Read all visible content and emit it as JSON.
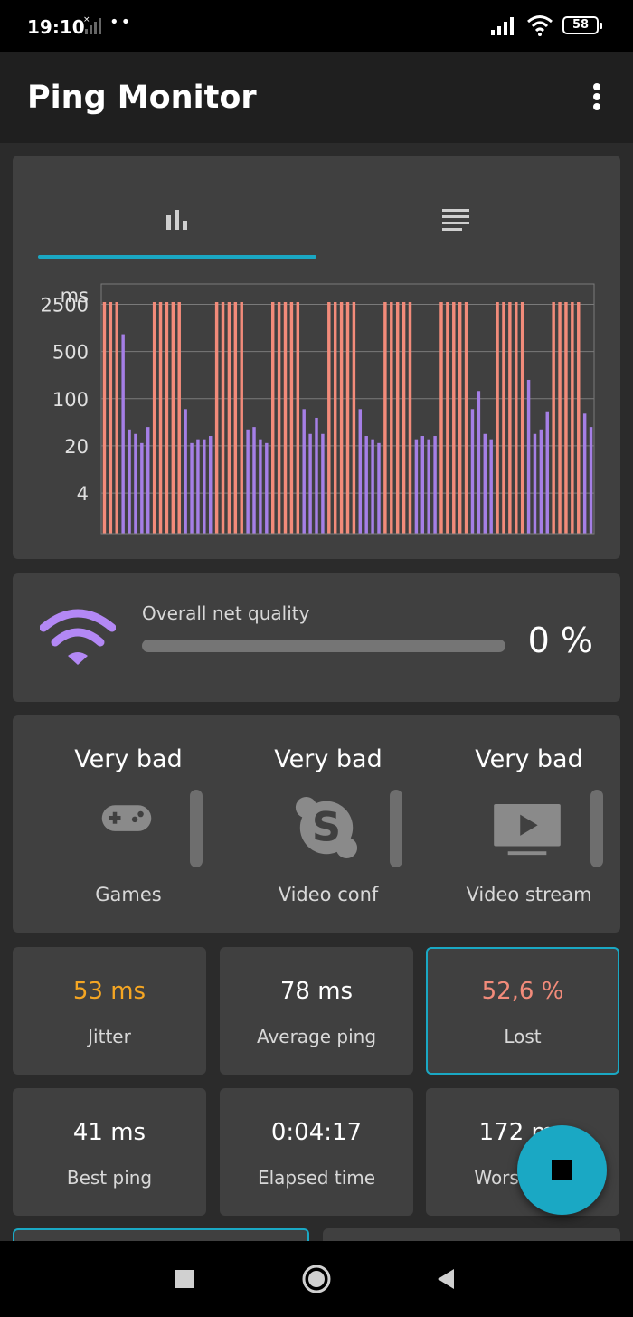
{
  "status_bar": {
    "time": "19:10",
    "dots": "••",
    "battery": "58"
  },
  "app_bar": {
    "title": "Ping Monitor",
    "menu_icon": "more-vert-icon"
  },
  "chart_tabs": {
    "active": "graph",
    "items": [
      {
        "id": "graph",
        "icon": "bar-chart-icon"
      },
      {
        "id": "list",
        "icon": "list-icon"
      }
    ]
  },
  "colors": {
    "accent": "#1aa8c4",
    "lost": "#f28b7a",
    "ok": "#a57fe6",
    "jitter": "#f5a623",
    "lost_text": "#f28b7a"
  },
  "chart_data": {
    "type": "bar",
    "ylabel": "ms",
    "yscale": "log",
    "ytick_labels": [
      "2500",
      "500",
      "100",
      "20",
      "4"
    ],
    "ytick_values": [
      2500,
      500,
      100,
      20,
      4
    ],
    "ylim": [
      1,
      5000
    ],
    "grid": true,
    "legend": "none",
    "values": [
      "lost",
      "lost",
      "lost",
      900,
      35,
      30,
      22,
      38,
      "lost",
      "lost",
      "lost",
      "lost",
      "lost",
      70,
      22,
      25,
      25,
      28,
      "lost",
      "lost",
      "lost",
      "lost",
      "lost",
      35,
      38,
      25,
      22,
      "lost",
      "lost",
      "lost",
      "lost",
      "lost",
      70,
      30,
      52,
      30,
      "lost",
      "lost",
      "lost",
      "lost",
      "lost",
      70,
      28,
      25,
      22,
      "lost",
      "lost",
      "lost",
      "lost",
      "lost",
      25,
      28,
      25,
      28,
      "lost",
      "lost",
      "lost",
      "lost",
      "lost",
      70,
      130,
      30,
      25,
      "lost",
      "lost",
      "lost",
      "lost",
      "lost",
      190,
      30,
      35,
      65,
      "lost",
      "lost",
      "lost",
      "lost",
      "lost",
      60,
      38
    ]
  },
  "net_quality": {
    "label": "Overall net quality",
    "value_text": "0 %",
    "value_percent": 0,
    "icon": "wifi-icon"
  },
  "app_ratings": [
    {
      "rating": "Very bad",
      "name": "Games",
      "icon": "gamepad-icon",
      "level": 0
    },
    {
      "rating": "Very bad",
      "name": "Video conf",
      "icon": "skype-icon",
      "level": 0
    },
    {
      "rating": "Very bad",
      "name": "Video stream",
      "icon": "tv-play-icon",
      "level": 0
    }
  ],
  "stats": [
    {
      "id": "jitter",
      "value": "53 ms",
      "label": "Jitter",
      "color": "#f5a623",
      "selected": false
    },
    {
      "id": "average-ping",
      "value": "78 ms",
      "label": "Average ping",
      "color": "#ffffff",
      "selected": false
    },
    {
      "id": "lost",
      "value": "52,6 %",
      "label": "Lost",
      "color": "#f28b7a",
      "selected": true
    },
    {
      "id": "best-ping",
      "value": "41 ms",
      "label": "Best ping",
      "color": "#ffffff",
      "selected": false
    },
    {
      "id": "elapsed-time",
      "value": "0:04:17",
      "label": "Elapsed time",
      "color": "#ffffff",
      "selected": false
    },
    {
      "id": "worst-ping",
      "value": "172 ms",
      "label": "Worst ping",
      "color": "#ffffff",
      "selected": false
    }
  ],
  "fab": {
    "icon": "stop-icon"
  },
  "nav_bar": {
    "items": [
      {
        "id": "recents",
        "icon": "square-icon"
      },
      {
        "id": "home",
        "icon": "home-circle-icon"
      },
      {
        "id": "back",
        "icon": "back-triangle-icon"
      }
    ]
  }
}
